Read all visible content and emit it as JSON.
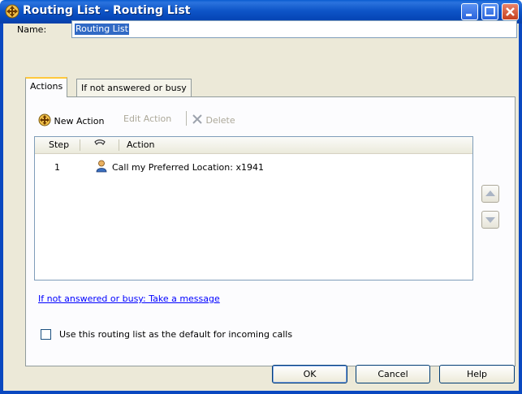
{
  "window": {
    "title": "Routing List - Routing List",
    "icons": {
      "app": "routing-move-icon",
      "minimize": "minimize-icon",
      "maximize": "maximize-icon",
      "close": "close-icon"
    }
  },
  "name_field": {
    "label": "Name:",
    "value": "Routing List"
  },
  "tabs": [
    {
      "label": "Actions",
      "selected": true
    },
    {
      "label": "If not answered or busy",
      "selected": false
    }
  ],
  "toolbar": {
    "new_action": "New Action",
    "edit_action": "Edit Action",
    "delete": "Delete",
    "icons": {
      "new": "routing-move-icon",
      "delete": "delete-x-icon"
    }
  },
  "grid": {
    "columns": {
      "step": "Step",
      "icon": "phone-handset-icon",
      "action": "Action"
    },
    "rows": [
      {
        "step": "1",
        "icon": "person-icon",
        "action": "Call my Preferred Location: x1941"
      }
    ]
  },
  "side_buttons": {
    "up": "move-up-arrow-icon",
    "down": "move-down-arrow-icon"
  },
  "link_text": "If not answered or busy: Take a message",
  "default_checkbox": {
    "label": "Use this routing list as the default for incoming calls",
    "checked": false
  },
  "buttons": {
    "ok": "OK",
    "cancel": "Cancel",
    "help": "Help"
  },
  "colors": {
    "title_bar": "#0a5ccf",
    "dialog_bg": "#ece9d8",
    "selection": "#316ac5",
    "link": "#0000ff",
    "tab_highlight": "#ffc83c"
  }
}
